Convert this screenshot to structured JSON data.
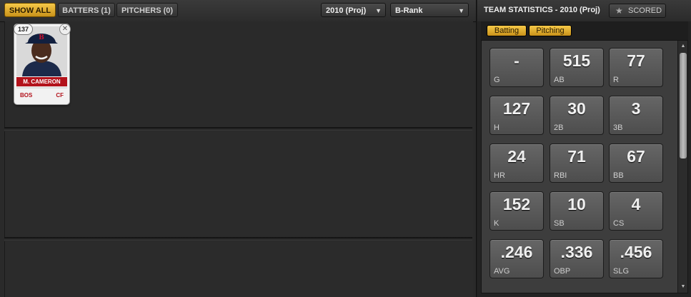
{
  "filters": {
    "show_all": "SHOW ALL",
    "batters": "BATTERS (1)",
    "pitchers": "PITCHERS (0)"
  },
  "season_select": {
    "value": "2010 (Proj)"
  },
  "rank_select": {
    "value": "B-Rank"
  },
  "player_card": {
    "rank": "137",
    "name": "M. CAMERON",
    "team": "BOS",
    "position": "CF"
  },
  "stats_panel": {
    "title": "TEAM STATISTICS - 2010 (Proj)",
    "scored_label": "SCORED",
    "tabs": [
      "Batting",
      "Pitching"
    ],
    "tiles": [
      {
        "label": "G",
        "value": "-"
      },
      {
        "label": "AB",
        "value": "515"
      },
      {
        "label": "R",
        "value": "77"
      },
      {
        "label": "H",
        "value": "127"
      },
      {
        "label": "2B",
        "value": "30"
      },
      {
        "label": "3B",
        "value": "3"
      },
      {
        "label": "HR",
        "value": "24"
      },
      {
        "label": "RBI",
        "value": "71"
      },
      {
        "label": "BB",
        "value": "67"
      },
      {
        "label": "K",
        "value": "152"
      },
      {
        "label": "SB",
        "value": "10"
      },
      {
        "label": "CS",
        "value": "4"
      },
      {
        "label": "AVG",
        "value": ".246"
      },
      {
        "label": "OBP",
        "value": ".336"
      },
      {
        "label": "SLG",
        "value": ".456"
      }
    ]
  },
  "colors": {
    "accent_gold": "#f6c948",
    "team_red": "#b3121b"
  }
}
